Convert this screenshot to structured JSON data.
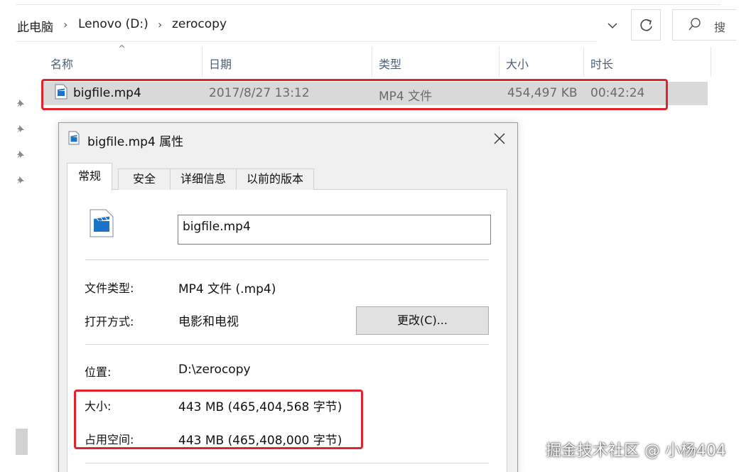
{
  "breadcrumb": [
    "此电脑",
    "Lenovo (D:)",
    "zerocopy"
  ],
  "search": {
    "placeholder": "搜"
  },
  "columns": {
    "name": "名称",
    "date": "日期",
    "type": "类型",
    "size": "大小",
    "duration": "时长"
  },
  "file": {
    "name": "bigfile.mp4",
    "date": "2017/8/27 13:12",
    "type": "MP4 文件",
    "size": "454,497 KB",
    "duration": "00:42:24"
  },
  "dialog": {
    "title": "bigfile.mp4 属性",
    "tabs": [
      "常规",
      "安全",
      "详细信息",
      "以前的版本"
    ],
    "filename_value": "bigfile.mp4",
    "type_label": "文件类型:",
    "type_value": "MP4 文件 (.mp4)",
    "opens_label": "打开方式:",
    "opens_value": "电影和电视",
    "change_button": "更改(C)...",
    "location_label": "位置:",
    "location_value": "D:\\zerocopy",
    "size_label": "大小:",
    "size_value": "443 MB (465,404,568 字节)",
    "disk_label": "占用空间:",
    "disk_value": "443 MB (465,408,000 字节)"
  },
  "watermark": "掘金技术社区 @ 小杨404",
  "colors": {
    "highlight": "#e0242f",
    "header_text": "#4c607a",
    "selected_row": "#d9d9d9"
  }
}
